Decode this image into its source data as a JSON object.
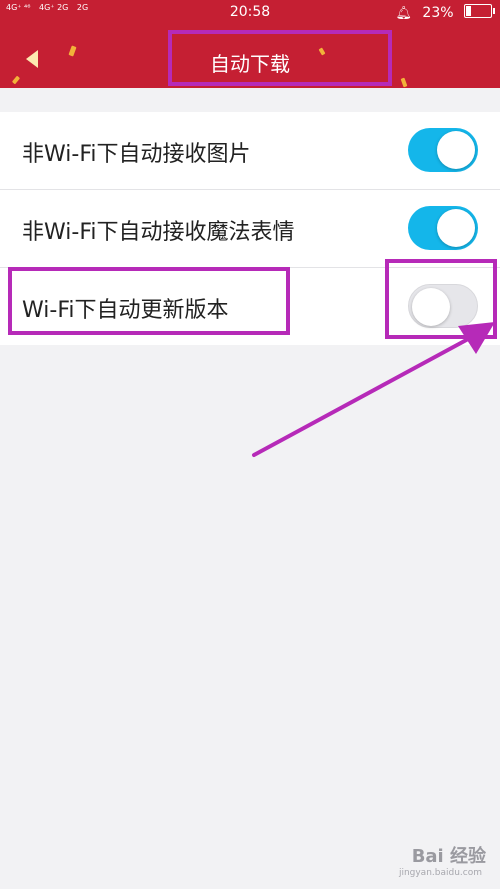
{
  "status_bar": {
    "network_1": "4G⁺ ⁴⁶",
    "network_2": "4G⁺ 2G",
    "network_3": "2G",
    "time": "20:58",
    "battery_percent": "23%"
  },
  "header": {
    "title": "自动下载",
    "back_icon": "back-arrow-icon",
    "background_color": "#c51f33"
  },
  "settings": [
    {
      "label": "非Wi-Fi下自动接收图片",
      "enabled": true
    },
    {
      "label": "非Wi-Fi下自动接收魔法表情",
      "enabled": true
    },
    {
      "label": "Wi-Fi下自动更新版本",
      "enabled": false
    }
  ],
  "annotation": {
    "highlight_color": "#b62ab8",
    "arrow_icon": "pointer-arrow"
  },
  "watermark": {
    "brand": "Bai 经验",
    "url": "jingyan.baidu.com"
  }
}
